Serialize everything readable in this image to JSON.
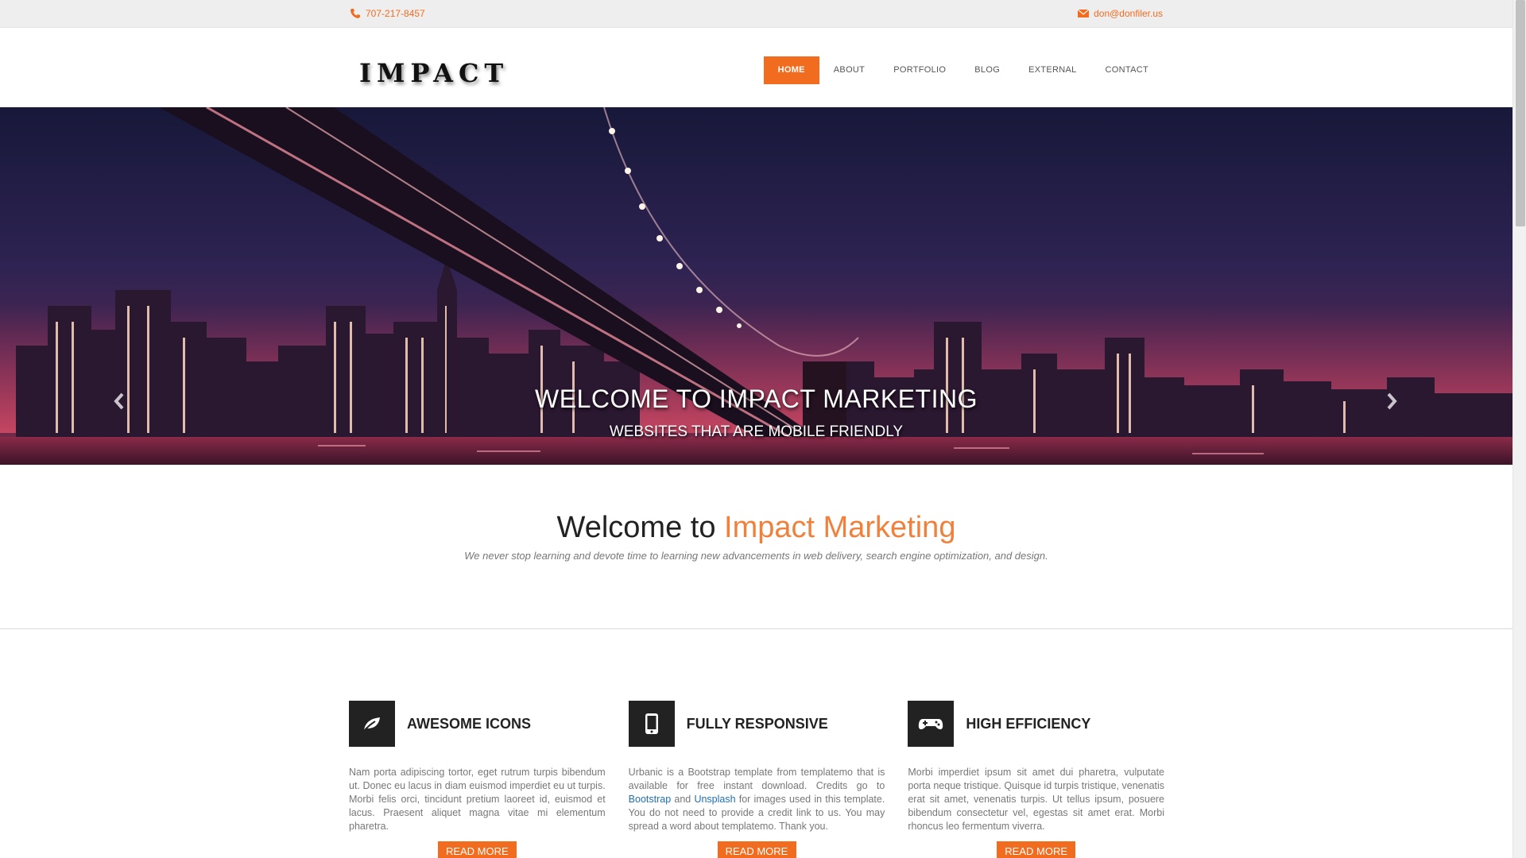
{
  "topbar": {
    "phone": "707-217-8457",
    "phone_icon": "phone-icon",
    "email": "don@donfiler.us",
    "email_icon": "envelope-icon"
  },
  "header": {
    "logo": "IMPACT",
    "nav": [
      {
        "label": "HOME",
        "active": true
      },
      {
        "label": "ABOUT",
        "active": false
      },
      {
        "label": "PORTFOLIO",
        "active": false
      },
      {
        "label": "BLOG",
        "active": false
      },
      {
        "label": "EXTERNAL",
        "active": false
      },
      {
        "label": "CONTACT",
        "active": false
      }
    ]
  },
  "hero": {
    "title": "WELCOME TO IMPACT MARKETING",
    "subtitle": "WEBSITES THAT ARE MOBILE FRIENDLY",
    "prev_icon": "chevron-left-icon",
    "next_icon": "chevron-right-icon",
    "slides_total": 3,
    "active_slide": 1
  },
  "welcome": {
    "title_plain": "Welcome to ",
    "title_accent": "Impact Marketing",
    "tagline": "We never stop learning and devote time to learning new advancements in web delivery, search engine optimization, and design."
  },
  "features": [
    {
      "icon": "leaf-icon",
      "title": "AWESOME ICONS",
      "text": "Nam porta adipiscing tortor, eget rutrum turpis bibendum ut. Donec eu lacus in diam euismod imperdiet eu ut turpis. Morbi felis orci, tincidunt pretium laoreet id, euismod et lacus. Praesent aliquet magna vitae mi elementum pharetra.",
      "button": "READ MORE"
    },
    {
      "icon": "mobile-phone-icon",
      "title": "FULLY RESPONSIVE",
      "text_before": "Urbanic is a Bootstrap template from templatemo that is available for free instant download. Credits go to ",
      "link1": "Bootstrap",
      "text_mid": " and ",
      "link2": "Unsplash",
      "text_after": " for images used in this template. You do not need to provide a credit link to us. You may spread a word about templatemo. Thank you.",
      "button": "READ MORE"
    },
    {
      "icon": "gamepad-icon",
      "title": "HIGH EFFICIENCY",
      "text": "Morbi imperdiet ipsum sit amet dui pharetra, vulputate porta neque tristique. Quisque id turpis tristique, venenatis erat sit amet, venenatis turpis. Ut tellus ipsum, posuere bibendum consectetur vel, egestas sit amet erat. Morbi rhoncus leo fermentum viverra.",
      "button": "READ MORE"
    }
  ],
  "colors": {
    "accent": "#f26c1f",
    "link": "#1e6fb1",
    "topbar_bg": "#eeeeee"
  }
}
